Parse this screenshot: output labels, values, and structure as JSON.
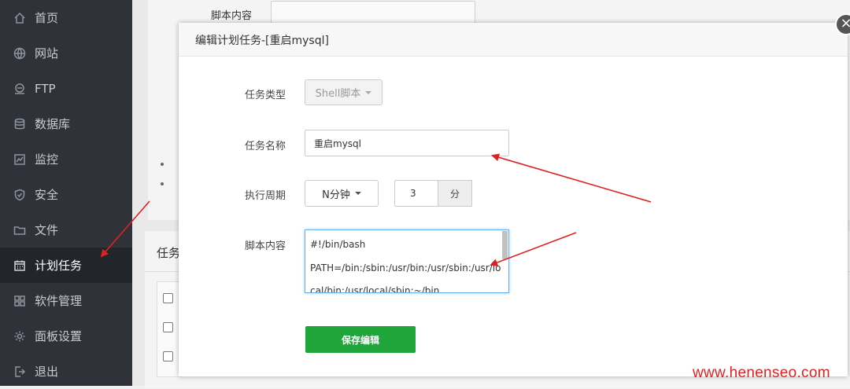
{
  "sidebar": {
    "items": [
      {
        "label": "首页",
        "icon": "home-icon"
      },
      {
        "label": "网站",
        "icon": "globe-icon"
      },
      {
        "label": "FTP",
        "icon": "ftp-icon"
      },
      {
        "label": "数据库",
        "icon": "database-icon"
      },
      {
        "label": "监控",
        "icon": "monitor-icon"
      },
      {
        "label": "安全",
        "icon": "shield-icon"
      },
      {
        "label": "文件",
        "icon": "folder-icon"
      },
      {
        "label": "计划任务",
        "icon": "calendar-icon",
        "active": true
      },
      {
        "label": "软件管理",
        "icon": "grid-icon"
      },
      {
        "label": "面板设置",
        "icon": "gear-icon"
      },
      {
        "label": "退出",
        "icon": "logout-icon"
      }
    ]
  },
  "background": {
    "script_label": "脚本内容",
    "section_title_fragment": "任务"
  },
  "modal": {
    "title": "编辑计划任务-[重启mysql]",
    "close_symbol": "×",
    "task_type_label": "任务类型",
    "task_type_value": "Shell脚本",
    "task_name_label": "任务名称",
    "task_name_value": "重启mysql",
    "period_label": "执行周期",
    "period_type_value": "N分钟",
    "period_number_value": "3",
    "period_unit": "分",
    "script_label": "脚本内容",
    "script_lines": [
      "#!/bin/bash",
      "PATH=/bin:/sbin:/usr/bin:/usr/sbin:/usr/lo",
      "cal/bin:/usr/local/sbin:~/bin"
    ],
    "save_label": "保存编辑"
  },
  "watermark": "www.henenseo.com",
  "colors": {
    "sidebar_bg": "#2f3339",
    "sidebar_active_bg": "#22262b",
    "save_button": "#20a53a",
    "annotation_arrow": "#e02020"
  }
}
